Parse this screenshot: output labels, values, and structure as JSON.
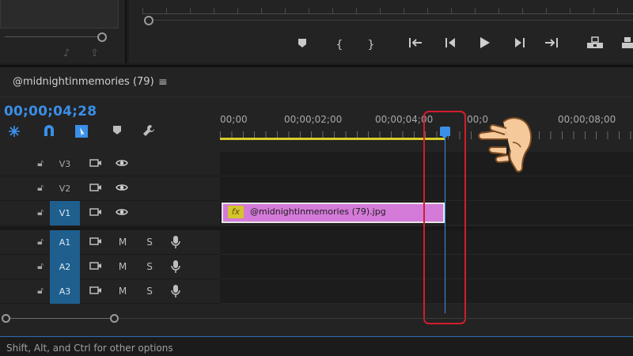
{
  "sequence": {
    "tab_title": "@midnightinmemories (79)",
    "timecode": "00;00;04;28"
  },
  "ruler": {
    "labels": [
      "00;00",
      "00;00;02;00",
      "00;00;04;00",
      "00;0",
      "00;00;08;00"
    ]
  },
  "tracks": {
    "video": [
      {
        "name": "V3",
        "selected": false
      },
      {
        "name": "V2",
        "selected": false
      },
      {
        "name": "V1",
        "selected": true
      }
    ],
    "audio": [
      {
        "name": "A1",
        "mute": "M",
        "solo": "S"
      },
      {
        "name": "A2",
        "mute": "M",
        "solo": "S"
      },
      {
        "name": "A3",
        "mute": "M",
        "solo": "S"
      }
    ]
  },
  "clip": {
    "fx_label": "fx",
    "name": "@midnightinmemories (79).jpg"
  },
  "status_bar": {
    "text": "Shift, Alt, and Ctrl for other options"
  },
  "colors": {
    "accent": "#3a8fe8",
    "clip_fill": "#d47ad9",
    "workarea": "#d8cc2a",
    "highlight": "#d21d2d",
    "track_selected": "#1f5f8e"
  },
  "icons": {
    "hand": "pointing-hand-icon",
    "menu": "hamburger-menu-icon"
  }
}
